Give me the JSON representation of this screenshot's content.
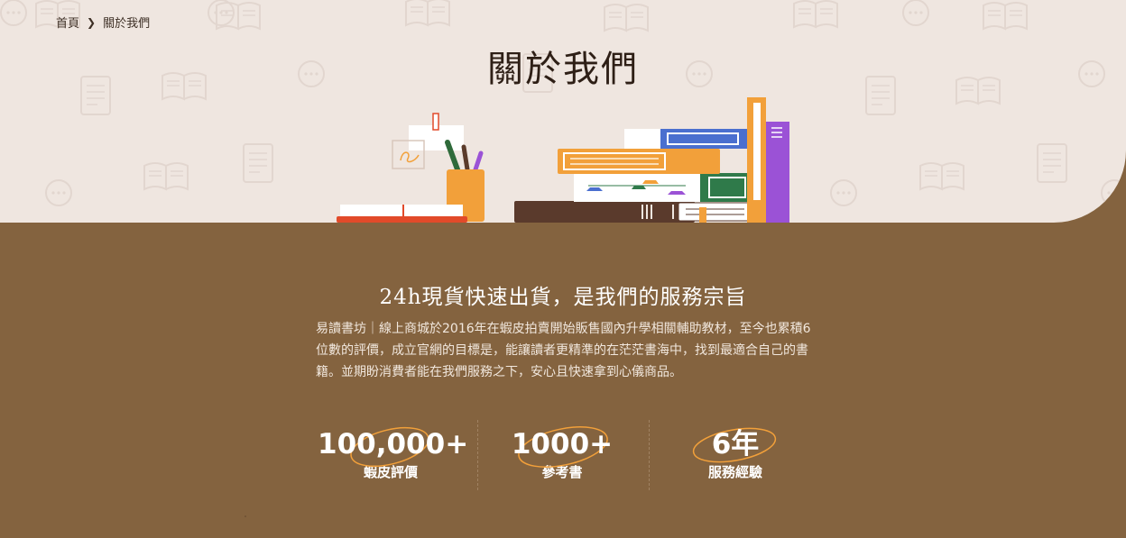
{
  "breadcrumb": {
    "home": "首頁",
    "separator_icon": "chevron-right-icon",
    "current": "關於我們"
  },
  "page_title": "關於我們",
  "about": {
    "slogan": "24h現貨快速出貨，是我們的服務宗旨",
    "intro": "易讀書坊｜線上商城於2016年在蝦皮拍賣開始販售國內升學相關輔助教材，至今也累積6位數的評價，成立官網的目標是，能讓讀者更精準的在茫茫書海中，找到最適合自己的書籍。並期盼消費者能在我們服務之下，安心且快速拿到心儀商品。"
  },
  "stats": [
    {
      "value": "100,000+",
      "label": "蝦皮評價"
    },
    {
      "value": "1000+",
      "label": "參考書"
    },
    {
      "value": "6年",
      "label": "服務經驗"
    }
  ],
  "colors": {
    "header_bg": "#efe6e0",
    "brown_bg": "#84633f",
    "accent_orange": "#f2a03a",
    "title_text": "#2e1f16"
  },
  "icons": [
    "book-icon",
    "document-icon",
    "chat-bubble-icon",
    "chevron-right-icon"
  ]
}
